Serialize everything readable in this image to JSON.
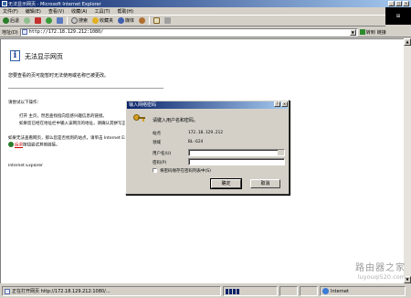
{
  "window": {
    "title": "无法显示网页 - Microsoft Internet Explorer",
    "controls": [
      "_",
      "□",
      "×"
    ]
  },
  "menu": [
    "文件(F)",
    "编辑(E)",
    "查看(V)",
    "收藏(A)",
    "工具(T)",
    "帮助(H)"
  ],
  "toolbar": {
    "back": "后退",
    "search": "搜索",
    "favorites": "收藏夹",
    "media": "媒体"
  },
  "address": {
    "label": "地址(D)",
    "url": "http://172.18.129.212:1080/",
    "go": "转到",
    "links": "链接"
  },
  "page": {
    "heading": "无法显示网页",
    "description": "您要查看的页可能暂时无法使用或名称已被更改。",
    "try_label": "请尝试以下操作：",
    "bullet1": "打开 主页，然后查找指向您感兴趣信息的链接。",
    "bullet2": "如果您已经在地址栏中输入该网页的地址，请确认其拼写正确。",
    "note1": "如果无法查看网页，那么您是否找到的站点，请单击 Internet Explorer",
    "back_link": "后退",
    "note2": "按钮尝试其他链接。",
    "footer": "Internet Explorer"
  },
  "dialog": {
    "title": "输入网络密码",
    "prompt": "请键入用户名和密码。",
    "site_label": "站点",
    "site_value": "172.18.129.212",
    "realm_label": "领域",
    "realm_value": "BL-624",
    "user_label": "用户名(U)",
    "pass_label": "密码(P)",
    "save_label": "将密码保存在密码列表中(S)",
    "ok": "确定",
    "cancel": "取消"
  },
  "status": {
    "text": "正在打开网页 http://172.18.129.212:1080/...",
    "zone": "Internet"
  },
  "watermark": {
    "cn": "路由器之家",
    "en": "luyouqi520.com"
  },
  "colors": {
    "titlebar": "#0a246a",
    "chrome": "#d4d0c8",
    "link": "#cc0000"
  }
}
